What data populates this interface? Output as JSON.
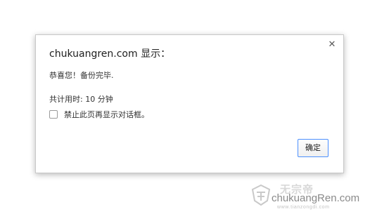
{
  "dialog": {
    "title": "chukuangren.com 显示：",
    "close_glyph": "✕",
    "message": "恭喜您！备份完毕.",
    "duration": "共计用时: 10 分钟",
    "suppress_label": "禁止此页再显示对话框。",
    "suppress_checked": false,
    "ok_label": "确定",
    "ok_border_color": "#4d90fe"
  },
  "watermark": {
    "site_cn": "无宗帝",
    "site_en": "chukuangRen.com",
    "url": "www.tianzongdi.com"
  }
}
